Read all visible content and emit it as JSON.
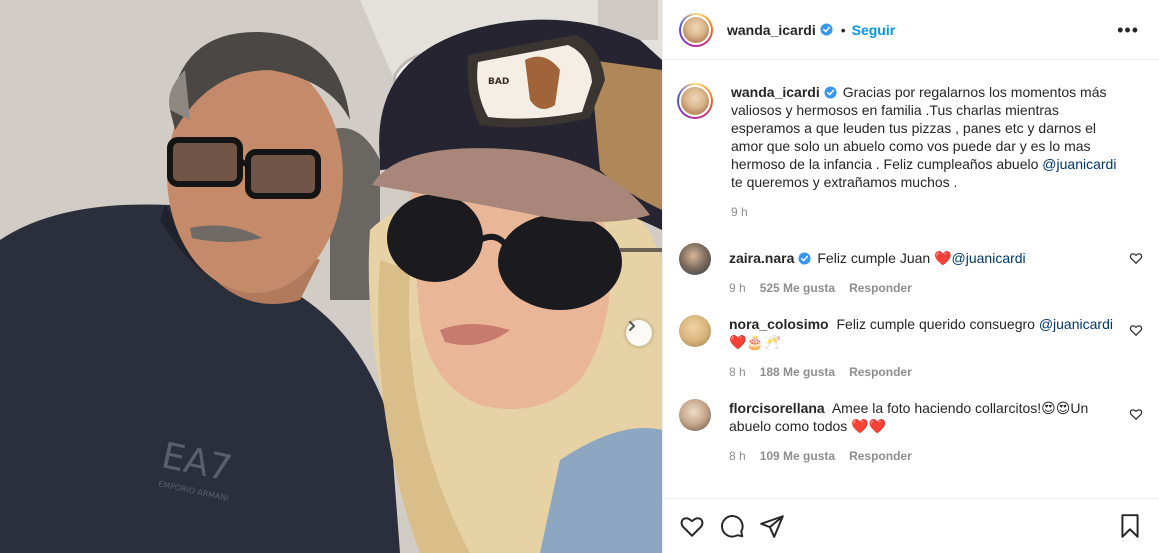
{
  "header": {
    "username": "wanda_icardi",
    "separator": "•",
    "follow_label": "Seguir",
    "more_label": "•••"
  },
  "caption": {
    "username": "wanda_icardi",
    "text_before": "Gracias por regalarnos los momentos más valiosos y hermosos en familia .Tus charlas mientras esperamos a que leuden tus pizzas , panes etc y darnos el amor que solo un abuelo como vos puede dar y es lo mas hermoso de la infancia . Feliz cumpleaños abuelo",
    "mention": "@juanicardi",
    "text_after": "te queremos y extrañamos muchos .",
    "time": "9 h"
  },
  "comments": [
    {
      "username": "zaira.nara",
      "verified": true,
      "text": "Feliz cumple Juan ❤️",
      "mention": "@juanicardi",
      "text_after": "",
      "time": "9 h",
      "likes": "525 Me gusta",
      "reply": "Responder"
    },
    {
      "username": "nora_colosimo",
      "verified": false,
      "text": "Feliz cumple querido consuegro",
      "mention": "@juanicardi",
      "text_after": "❤️🎂🥂",
      "time": "8 h",
      "likes": "188 Me gusta",
      "reply": "Responder"
    },
    {
      "username": "florcisorellana",
      "verified": false,
      "text": "Amee la foto haciendo collarcitos!😍😍Un abuelo como todos ❤️❤️",
      "mention": "",
      "text_after": "",
      "time": "8 h",
      "likes": "109 Me gusta",
      "reply": "Responder"
    }
  ],
  "photo": {
    "shirt_logo": "EA7",
    "shirt_logo_sub": "EMPORIO ARMANI",
    "cap_patch": "BAD"
  },
  "colors": {
    "accent_blue": "#0095f6",
    "verified_blue": "#3897f0",
    "mention": "#00376b",
    "muted": "#8e8e8e"
  },
  "icons": {
    "verified": "verified-badge-icon",
    "like": "heart-icon",
    "comment": "comment-icon",
    "share": "share-icon",
    "save": "bookmark-icon",
    "more": "more-options-icon",
    "next": "chevron-right-icon"
  }
}
